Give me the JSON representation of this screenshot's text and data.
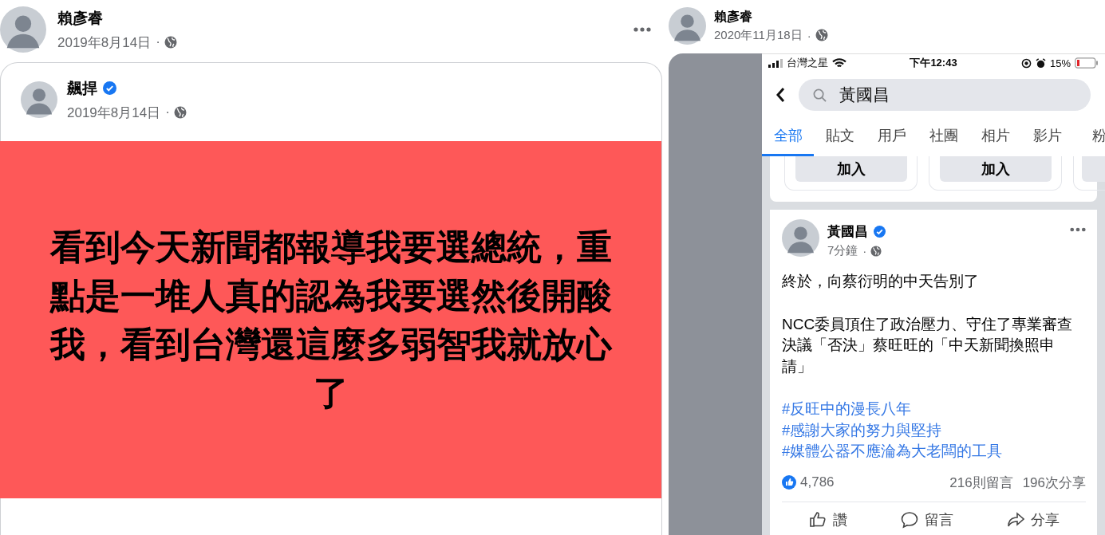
{
  "left_post": {
    "author": "賴彥睿",
    "date": "2019年8月14日",
    "separator": "·",
    "shared": {
      "author": "飆捍",
      "verified": true,
      "date": "2019年8月14日",
      "separator": "·",
      "text": "看到今天新聞都報導我要選總統，重點是一堆人真的認為我要選然後開酸我，看到台灣還這麼多弱智我就放心了"
    }
  },
  "right_post": {
    "author": "賴彥睿",
    "date": "2020年11月18日",
    "separator": "·",
    "screenshot": {
      "status_bar": {
        "carrier": "台灣之星",
        "time": "下午12:43",
        "battery": "15%"
      },
      "search": {
        "value": "黃國昌"
      },
      "tabs": [
        {
          "label": "全部",
          "selected": true
        },
        {
          "label": "貼文",
          "selected": false
        },
        {
          "label": "用戶",
          "selected": false
        },
        {
          "label": "社團",
          "selected": false
        },
        {
          "label": "相片",
          "selected": false
        },
        {
          "label": "影片",
          "selected": false
        },
        {
          "label": "粉",
          "selected": false
        }
      ],
      "join_buttons": [
        "加入",
        "加入"
      ],
      "post": {
        "author": "黃國昌",
        "verified": true,
        "time": "7分鐘",
        "separator": "·",
        "paragraphs": [
          "終於，向蔡衍明的中天告別了",
          "NCC委員頂住了政治壓力、守住了專業審查決議「否決」蔡旺旺的「中天新聞換照申請」"
        ],
        "hashtags": [
          "#反旺中的漫長八年",
          "#感謝大家的努力與堅持",
          "#媒體公器不應淪為大老闆的工具"
        ],
        "likes": "4,786",
        "comments": "216則留言",
        "shares": "196次分享",
        "actions": [
          {
            "kind": "like",
            "label": "讚"
          },
          {
            "kind": "comment",
            "label": "留言"
          },
          {
            "kind": "share",
            "label": "分享"
          }
        ]
      }
    }
  }
}
